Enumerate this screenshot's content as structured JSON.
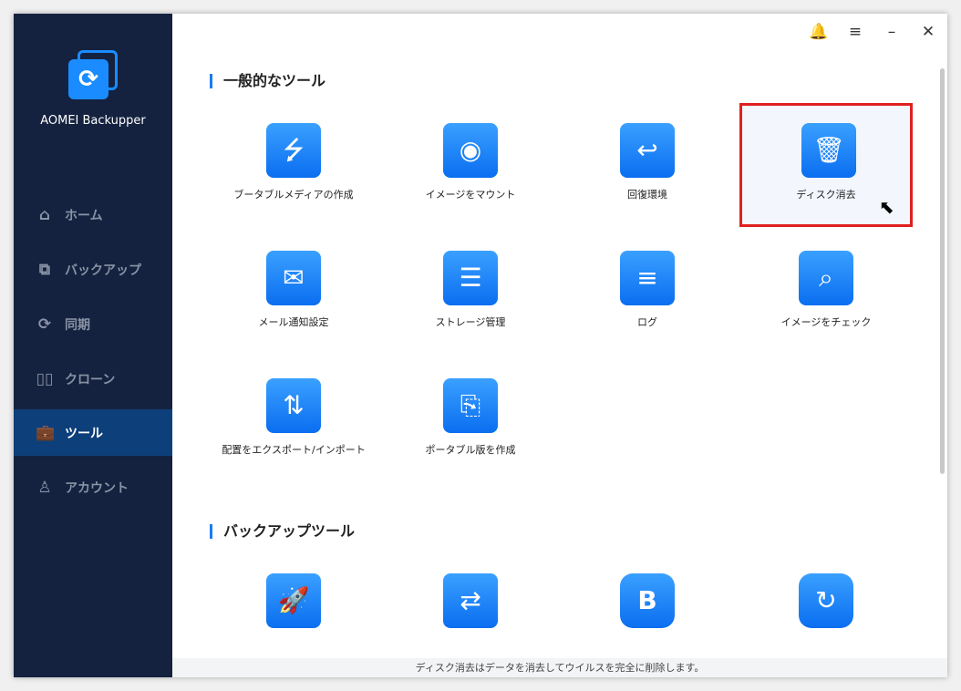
{
  "app": {
    "name": "AOMEI Backupper"
  },
  "nav": [
    {
      "label": "ホーム",
      "icon": "home-icon"
    },
    {
      "label": "バックアップ",
      "icon": "backup-icon"
    },
    {
      "label": "同期",
      "icon": "sync-icon"
    },
    {
      "label": "クローン",
      "icon": "clone-icon"
    },
    {
      "label": "ツール",
      "icon": "tools-icon",
      "active": true
    },
    {
      "label": "アカウント",
      "icon": "account-icon"
    }
  ],
  "sections": {
    "common": "一般的なツール",
    "backup": "バックアップツール"
  },
  "tools": [
    {
      "label": "ブータブルメディアの作成",
      "glyph": "⭍"
    },
    {
      "label": "イメージをマウント",
      "glyph": "◉"
    },
    {
      "label": "回復環境",
      "glyph": "↩"
    },
    {
      "label": "ディスク消去",
      "glyph": "🗑"
    },
    {
      "label": "メール通知設定",
      "glyph": "✉"
    },
    {
      "label": "ストレージ管理",
      "glyph": "☰"
    },
    {
      "label": "ログ",
      "glyph": "≡"
    },
    {
      "label": "イメージをチェック",
      "glyph": "⌕"
    },
    {
      "label": "配置をエクスポート/インポート",
      "glyph": "⇅"
    },
    {
      "label": "ポータブル版を作成",
      "glyph": "⎘"
    }
  ],
  "backup_tools": [
    {
      "glyph": "🚀"
    },
    {
      "glyph": "⇄"
    },
    {
      "glyph": "B"
    },
    {
      "glyph": "↻"
    }
  ],
  "status": "ディスク消去はデータを消去してウイルスを完全に削除します。"
}
